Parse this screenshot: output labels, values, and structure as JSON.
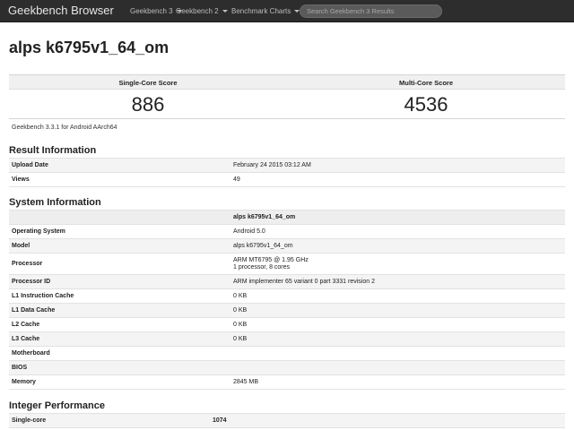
{
  "nav": {
    "brand": "Geekbench Browser",
    "items": [
      {
        "label": "Geekbench 3"
      },
      {
        "label": "Geekbench 2"
      },
      {
        "label": "Benchmark Charts"
      }
    ],
    "search_placeholder": "Search Geekbench 3 Results"
  },
  "title": "alps k6795v1_64_om",
  "scores": {
    "single_label": "Single-Core Score",
    "single_value": "886",
    "multi_label": "Multi-Core Score",
    "multi_value": "4536"
  },
  "caption": "Geekbench 3.3.1 for Android AArch64",
  "result_info": {
    "title": "Result Information",
    "rows": [
      {
        "key": "Upload Date",
        "value": "February 24 2015 03:12 AM"
      },
      {
        "key": "Views",
        "value": "49"
      }
    ]
  },
  "system_info": {
    "title": "System Information",
    "header": "alps k6795v1_64_om",
    "rows": [
      {
        "key": "Operating System",
        "value": "Android 5.0"
      },
      {
        "key": "Model",
        "value": "alps k6795v1_64_om"
      },
      {
        "key": "Processor",
        "value": "ARM MT6795 @ 1.95 GHz",
        "value2": "1 processor, 8 cores"
      },
      {
        "key": "Processor ID",
        "value": "ARM implementer 65 variant 0 part 3331 revision 2"
      },
      {
        "key": "L1 Instruction Cache",
        "value": "0 KB"
      },
      {
        "key": "L1 Data Cache",
        "value": "0 KB"
      },
      {
        "key": "L2 Cache",
        "value": "0 KB"
      },
      {
        "key": "L3 Cache",
        "value": "0 KB"
      },
      {
        "key": "Motherboard",
        "value": ""
      },
      {
        "key": "BIOS",
        "value": ""
      },
      {
        "key": "Memory",
        "value": "2845 MB"
      }
    ]
  },
  "integer_perf": {
    "title": "Integer Performance",
    "rows": [
      {
        "key": "Single-core",
        "value": "1074"
      }
    ]
  }
}
